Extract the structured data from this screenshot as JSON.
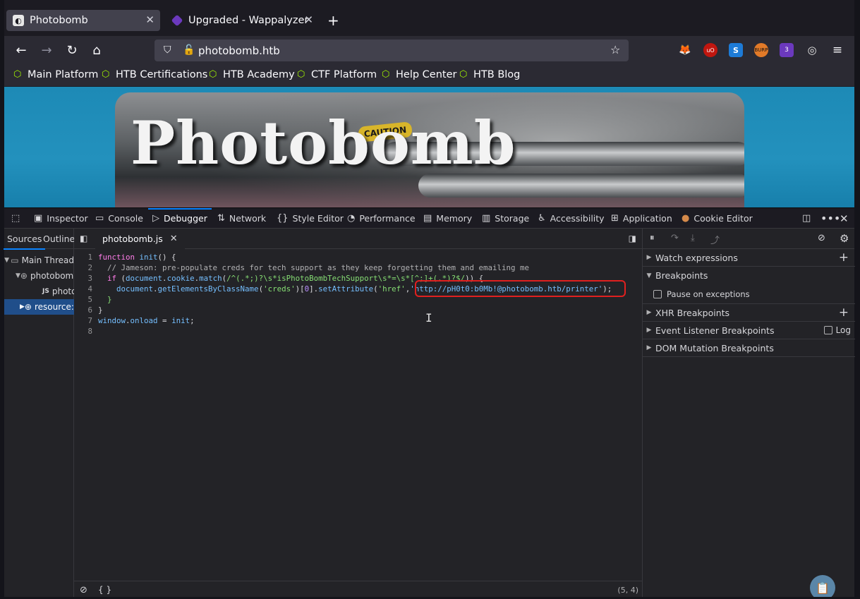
{
  "tabs": [
    {
      "title": "Photobomb",
      "icon": "photobomb-favicon-icon",
      "active": true
    },
    {
      "title": "Upgraded - Wappalyzer",
      "icon": "wappalyzer-favicon-icon",
      "active": false
    }
  ],
  "navbar": {
    "url": "photobomb.htb"
  },
  "extensions": [
    {
      "name": "foxyproxy-icon",
      "color": "#e8e8e8"
    },
    {
      "name": "ublock-origin-icon",
      "color": "#c0160f",
      "label": "uO"
    },
    {
      "name": "s-extension-icon",
      "color": "#1d7bd7",
      "label": "S"
    },
    {
      "name": "burp-proxy-icon",
      "color": "#e27a28",
      "label": "BURP"
    },
    {
      "name": "wappalyzer-extension-icon",
      "color": "#6b39bd",
      "badge": "3"
    },
    {
      "name": "cookie-editor-extension-icon",
      "color": "#e8e8e8"
    }
  ],
  "bookmarks": [
    {
      "label": "Main Platform"
    },
    {
      "label": "HTB Certifications"
    },
    {
      "label": "HTB Academy"
    },
    {
      "label": "CTF Platform"
    },
    {
      "label": "Help Center"
    },
    {
      "label": "HTB Blog"
    }
  ],
  "page": {
    "title": "Photobomb",
    "warning_label": "CAUTION"
  },
  "devtools": {
    "tabs": [
      {
        "label": "Inspector",
        "icon": "inspector-icon"
      },
      {
        "label": "Console",
        "icon": "console-icon"
      },
      {
        "label": "Debugger",
        "icon": "debugger-icon",
        "active": true
      },
      {
        "label": "Network",
        "icon": "network-icon"
      },
      {
        "label": "Style Editor",
        "icon": "style-editor-icon"
      },
      {
        "label": "Performance",
        "icon": "performance-icon"
      },
      {
        "label": "Memory",
        "icon": "memory-icon"
      },
      {
        "label": "Storage",
        "icon": "storage-icon"
      },
      {
        "label": "Accessibility",
        "icon": "accessibility-icon"
      },
      {
        "label": "Application",
        "icon": "application-icon"
      },
      {
        "label": "Cookie Editor",
        "icon": "cookie-icon"
      }
    ],
    "sources_tabs": {
      "sources": "Sources",
      "outline": "Outline"
    },
    "tree": {
      "main_thread": "Main Thread",
      "host": "photobomb.htb",
      "file": "photobomb.js",
      "resource": "resource://"
    },
    "editor": {
      "file_tab": "photobomb.js",
      "line_numbers": [
        "1",
        "2",
        "3",
        "4",
        "5",
        "6",
        "7",
        "8"
      ],
      "cursor_position": "(5, 4)",
      "pretty_print": "{ }"
    },
    "code": {
      "l1_kw": "function",
      "l1_fn": "init",
      "l1_rest": "() {",
      "l2": "  // Jameson: pre-populate creds for tech support as they keep forgetting them and emailing me",
      "l3_kw": "  if",
      "l3_a": " (",
      "l3_obj": "document",
      "l3_b": ".",
      "l3_prop": "cookie",
      "l3_c": ".",
      "l3_method": "match",
      "l3_d": "(",
      "l3_regex": "/^(.*;)?\\s*isPhotoBombTechSupport\\s*=\\s*[^;]+(.*)?$/",
      "l3_e": ")) {",
      "l4_a": "    ",
      "l4_obj": "document",
      "l4_b": ".",
      "l4_method": "getElementsByClassName",
      "l4_c": "(",
      "l4_str1": "'creds'",
      "l4_d": ")[",
      "l4_num": "0",
      "l4_e": "].",
      "l4_method2": "setAttribute",
      "l4_f": "(",
      "l4_str2": "'href'",
      "l4_g": ",",
      "l4_str3": "'http://pH0t0:b0Mb!@photobomb.htb/printer'",
      "l4_h": ");",
      "l5": "  }",
      "l6": "}",
      "l7_obj": "window",
      "l7_a": ".",
      "l7_prop": "onload",
      "l7_b": " = ",
      "l7_fn": "init",
      "l7_c": ";"
    },
    "right_pane": {
      "watch": "Watch expressions",
      "breakpoints": "Breakpoints",
      "pause_exceptions": "Pause on exceptions",
      "xhr": "XHR Breakpoints",
      "event_listener": "Event Listener Breakpoints",
      "log": "Log",
      "dom_mutation": "DOM Mutation Breakpoints"
    }
  }
}
